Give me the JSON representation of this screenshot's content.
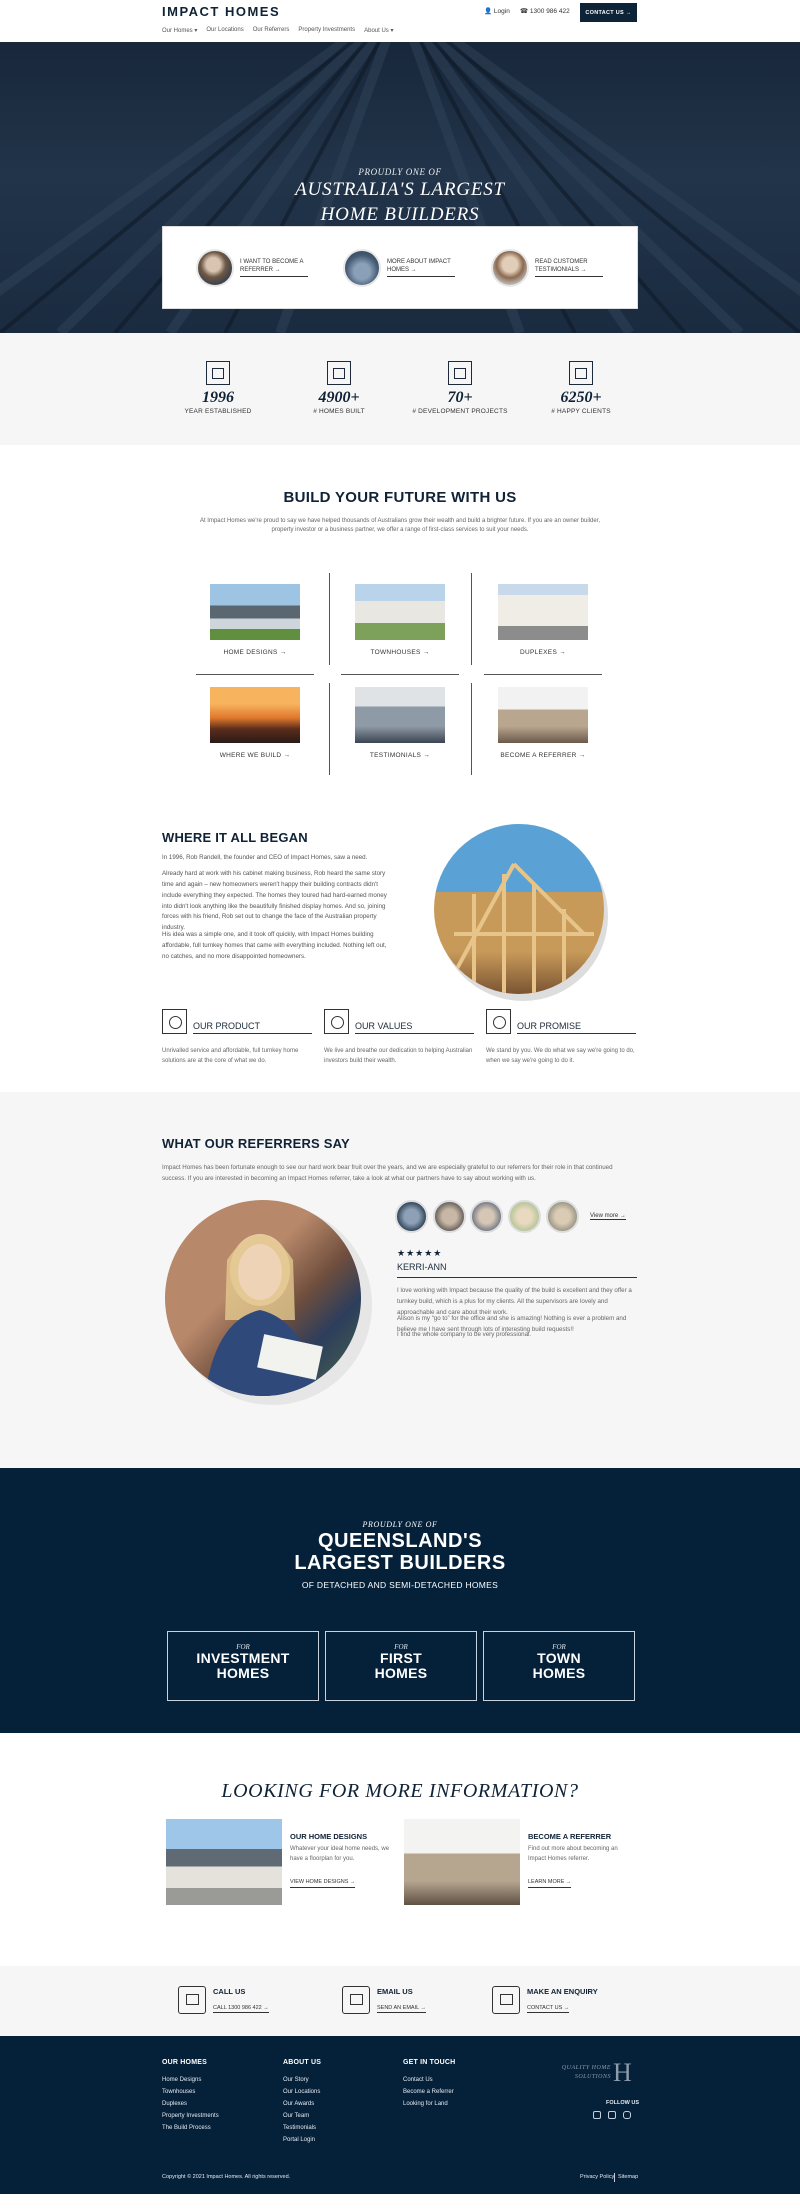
{
  "header": {
    "logo": "IMPACT HOMES",
    "login": "Login",
    "phone": "1300 986 422",
    "contact_btn": "CONTACT US →",
    "nav": [
      "Our Homes ▾",
      "Our Locations",
      "Our Referrers",
      "Property Investments",
      "About Us ▾"
    ]
  },
  "hero": {
    "kicker": "PROUDLY ONE OF",
    "title_1": "AUSTRALIA'S LARGEST",
    "title_2": "HOME BUILDERS",
    "cards": [
      {
        "label": "I WANT TO BECOME A REFERRER →"
      },
      {
        "label": "MORE ABOUT IMPACT HOMES →"
      },
      {
        "label": "READ CUSTOMER TESTIMONIALS →"
      }
    ]
  },
  "stats": [
    {
      "num": "1996",
      "label": "YEAR ESTABLISHED",
      "icon": "certificate-icon"
    },
    {
      "num": "4900+",
      "label": "# HOMES BUILT",
      "icon": "house-icon"
    },
    {
      "num": "70+",
      "label": "# DEVELOPMENT PROJECTS",
      "icon": "map-icon"
    },
    {
      "num": "6250+",
      "label": "# HAPPY CLIENTS",
      "icon": "people-icon"
    }
  ],
  "build": {
    "title": "BUILD YOUR FUTURE WITH US",
    "sub": "At Impact Homes we're proud to say we have helped thousands of Australians grow their wealth and build a brighter future. If you are an owner builder, property investor or a business partner, we offer a range of first-class services to suit your needs.",
    "tiles": [
      "HOME DESIGNS →",
      "TOWNHOUSES →",
      "DUPLEXES →",
      "WHERE WE BUILD →",
      "TESTIMONIALS →",
      "BECOME A REFERRER →"
    ]
  },
  "began": {
    "title": "WHERE IT ALL BEGAN",
    "p1": "In 1996, Rob Randell, the founder and CEO of Impact Homes, saw a need.",
    "p2": "Already hard at work with his cabinet making business, Rob heard the same story time and again – new homeowners weren't happy their building contracts didn't include everything they expected. The homes they toured had hard-earned money into didn't look anything like the beautifully finished display homes. And so, joining forces with his friend, Rob set out to change the face of the Australian property industry.",
    "p3": "His idea was a simple one, and it took off quickly, with Impact Homes building affordable, full turnkey homes that came with everything included. Nothing left out, no catches, and no more disappointed homeowners.",
    "pillars": [
      {
        "title": "OUR PRODUCT",
        "text": "Unrivalled service and affordable, full turnkey home solutions are at the core of what we do."
      },
      {
        "title": "OUR VALUES",
        "text": "We live and breathe our dedication to helping Australian investors build their wealth."
      },
      {
        "title": "OUR PROMISE",
        "text": "We stand by you. We do what we say we're going to do, when we say we're going to do it."
      }
    ]
  },
  "referrers": {
    "title": "WHAT OUR REFERRERS SAY",
    "sub": "Impact Homes has been fortunate enough to see our hard work bear fruit over the years, and we are especially grateful to our referrers for their role in that continued success. If you are interested in becoming an Impact Homes referrer, take a look at what our partners have to say about working with us.",
    "view_more": "View more →",
    "stars": "★★★★★",
    "name": "KERRI-ANN",
    "quote": [
      "I love working with Impact because the quality of the build is excellent and they offer a turnkey build, which is a plus for my clients. All the supervisors are lovely and approachable and care about their work.",
      "Alison is my “go to” for the office and she is amazing! Nothing is ever a problem and believe me I have sent through lots of interesting build requests!!",
      "I find the whole company to be very professional."
    ]
  },
  "qld": {
    "kicker": "PROUDLY ONE OF",
    "title_1": "QUEENSLAND'S",
    "title_2": "LARGEST BUILDERS",
    "sub": "OF DETACHED AND SEMI-DETACHED HOMES",
    "boxes": [
      {
        "for": "FOR",
        "l1": "INVESTMENT",
        "l2": "HOMES"
      },
      {
        "for": "FOR",
        "l1": "FIRST",
        "l2": "HOMES"
      },
      {
        "for": "FOR",
        "l1": "TOWN",
        "l2": "HOMES"
      }
    ]
  },
  "more": {
    "title": "LOOKING FOR MORE INFORMATION?",
    "cards": [
      {
        "title": "OUR HOME DESIGNS",
        "text": "Whatever your ideal home needs, we have a floorplan for you.",
        "link": "VIEW HOME DESIGNS →"
      },
      {
        "title": "BECOME A REFERRER",
        "text": "Find out more about becoming an Impact Homes referrer.",
        "link": "LEARN MORE →"
      }
    ]
  },
  "contact": [
    {
      "title": "CALL US",
      "link": "CALL 1300 986 422 →"
    },
    {
      "title": "EMAIL US",
      "link": "SEND AN EMAIL →"
    },
    {
      "title": "MAKE AN ENQUIRY",
      "link": "CONTACT US →"
    }
  ],
  "footer": {
    "cols": [
      {
        "title": "OUR HOMES",
        "links": [
          "Home Designs",
          "Townhouses",
          "Duplexes",
          "Property Investments",
          "The Build Process"
        ]
      },
      {
        "title": "ABOUT US",
        "links": [
          "Our Story",
          "Our Locations",
          "Our Awards",
          "Our Team",
          "Testimonials",
          "Portal Login"
        ]
      },
      {
        "title": "GET IN TOUCH",
        "links": [
          "Contact Us",
          "Become a Referrer",
          "Looking for Land"
        ]
      }
    ],
    "badge_1": "QUALITY HOME",
    "badge_2": "SOLUTIONS",
    "follow": "FOLLOW US",
    "copyright": "Copyright © 2021 Impact Homes. All rights reserved.",
    "privacy": "Privacy Policy",
    "sitemap": "Sitemap"
  }
}
